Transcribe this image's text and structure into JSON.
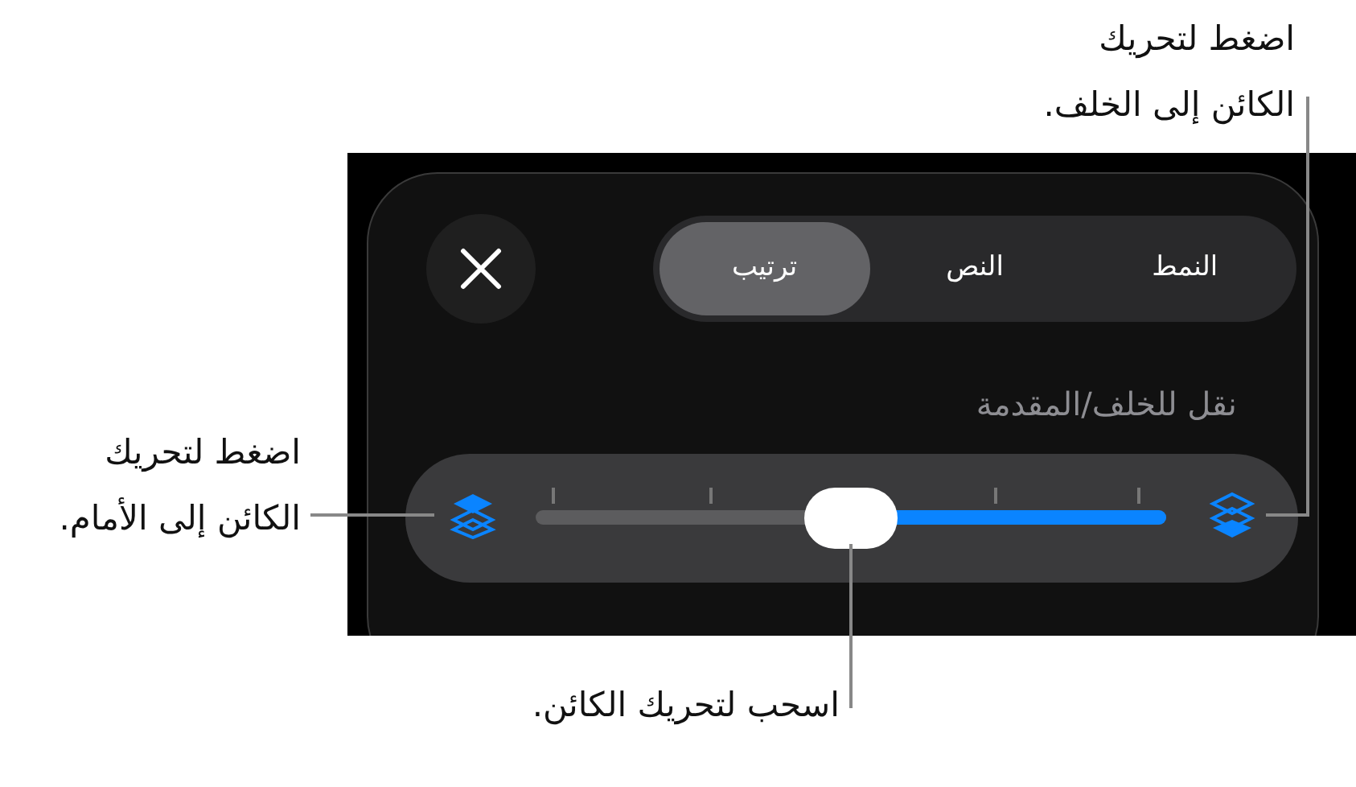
{
  "callouts": [
    {
      "kind": "top",
      "text": "اضغط لتحريك\nالكائن إلى الخلف."
    },
    {
      "kind": "left",
      "text": "اضغط لتحريك\nالكائن إلى الأمام."
    },
    {
      "kind": "bottom",
      "text": "اسحب لتحريك الكائن."
    }
  ],
  "tabs": [
    {
      "label": "النمط",
      "selected": false
    },
    {
      "label": "النص",
      "selected": false
    },
    {
      "label": "ترتيب",
      "selected": true
    }
  ],
  "section_label": "نقل للخلف/المقدمة",
  "slider": {
    "level": 0.5
  }
}
